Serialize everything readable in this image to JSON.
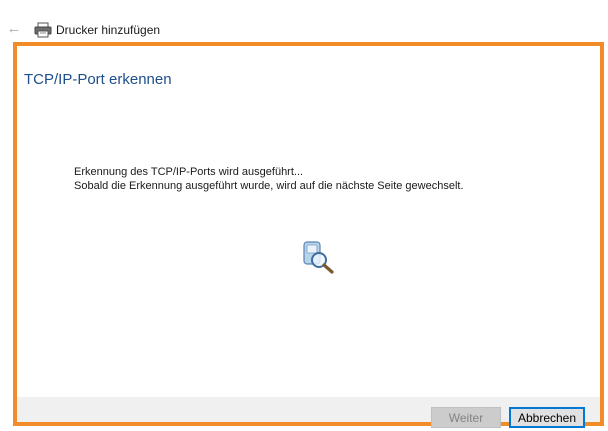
{
  "window": {
    "title": "Drucker hinzufügen",
    "back_icon": "back-arrow-icon",
    "app_icon": "printer-icon"
  },
  "page": {
    "heading": "TCP/IP-Port erkennen",
    "message_line1": "Erkennung des TCP/IP-Ports wird ausgeführt...",
    "message_line2": "Sobald die Erkennung ausgeführt wurde, wird auf die nächste Seite gewechselt.",
    "animation_icon": "search-magnifier-icon"
  },
  "buttons": {
    "next_label": "Weiter",
    "next_enabled": false,
    "cancel_label": "Abbrechen"
  },
  "colors": {
    "heading": "#1e4e8c",
    "highlight_frame": "#f28c28",
    "focus_border": "#0078d7"
  }
}
